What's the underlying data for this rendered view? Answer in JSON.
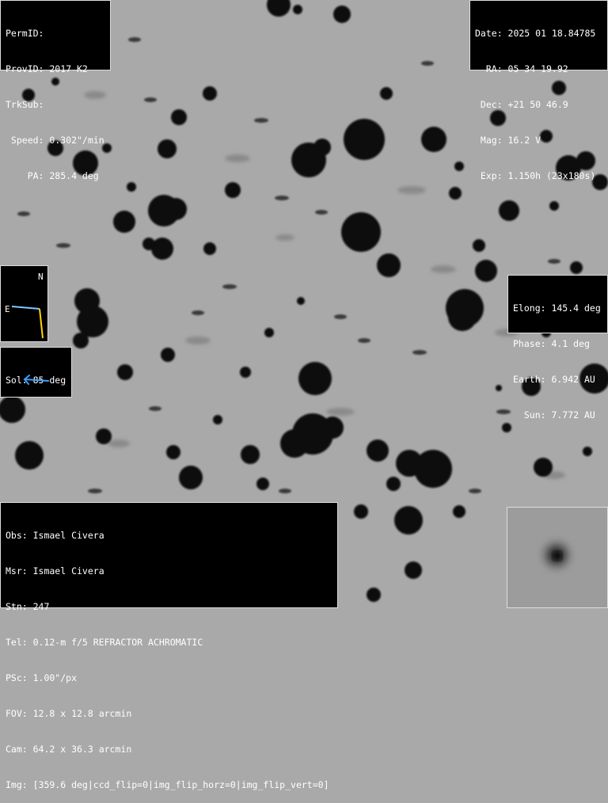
{
  "header_left": {
    "perm_id": "PermID:",
    "prov_id": "ProvID: 2017 K2",
    "trk_sub": "TrkSub:",
    "speed": " Speed: 0.302\"/min",
    "pa": "    PA: 285.4 deg"
  },
  "header_right": {
    "date": "Date: 2025 01 18.84785",
    "ra": "  RA: 05 34 19.92",
    "dec": " Dec: +21 50 46.9",
    "mag": " Mag: 16.2 V",
    "exp": " Exp: 1.150h (23x180s)"
  },
  "geometry_info": {
    "elong": "Elong: 145.4 deg",
    "phase": "Phase: 4.1 deg",
    "earth": "Earth: 6.942 AU",
    "sun": "  Sun: 7.772 AU"
  },
  "compass": {
    "north": "N",
    "east": "E",
    "east_color": "#7fc8ff",
    "north_color": "#ffd400"
  },
  "sol": {
    "label": "Sol: 85 deg",
    "arrow_color": "#3aa0ff"
  },
  "observer": {
    "obs": "Obs: Ismael Civera",
    "msr": "Msr: Ismael Civera",
    "stn": "Stn: 247",
    "tel": "Tel: 0.12-m f/5 REFRACTOR ACHROMATIC",
    "psc": "PSc: 1.00\"/px",
    "fov": "FOV: 12.8 x 12.8 arcmin",
    "cam": "Cam: 64.2 x 36.3 arcmin",
    "img": "Img: [359.6 deg|ccd_flip=0|img_flip_horz=0|img_flip_vert=0]"
  }
}
